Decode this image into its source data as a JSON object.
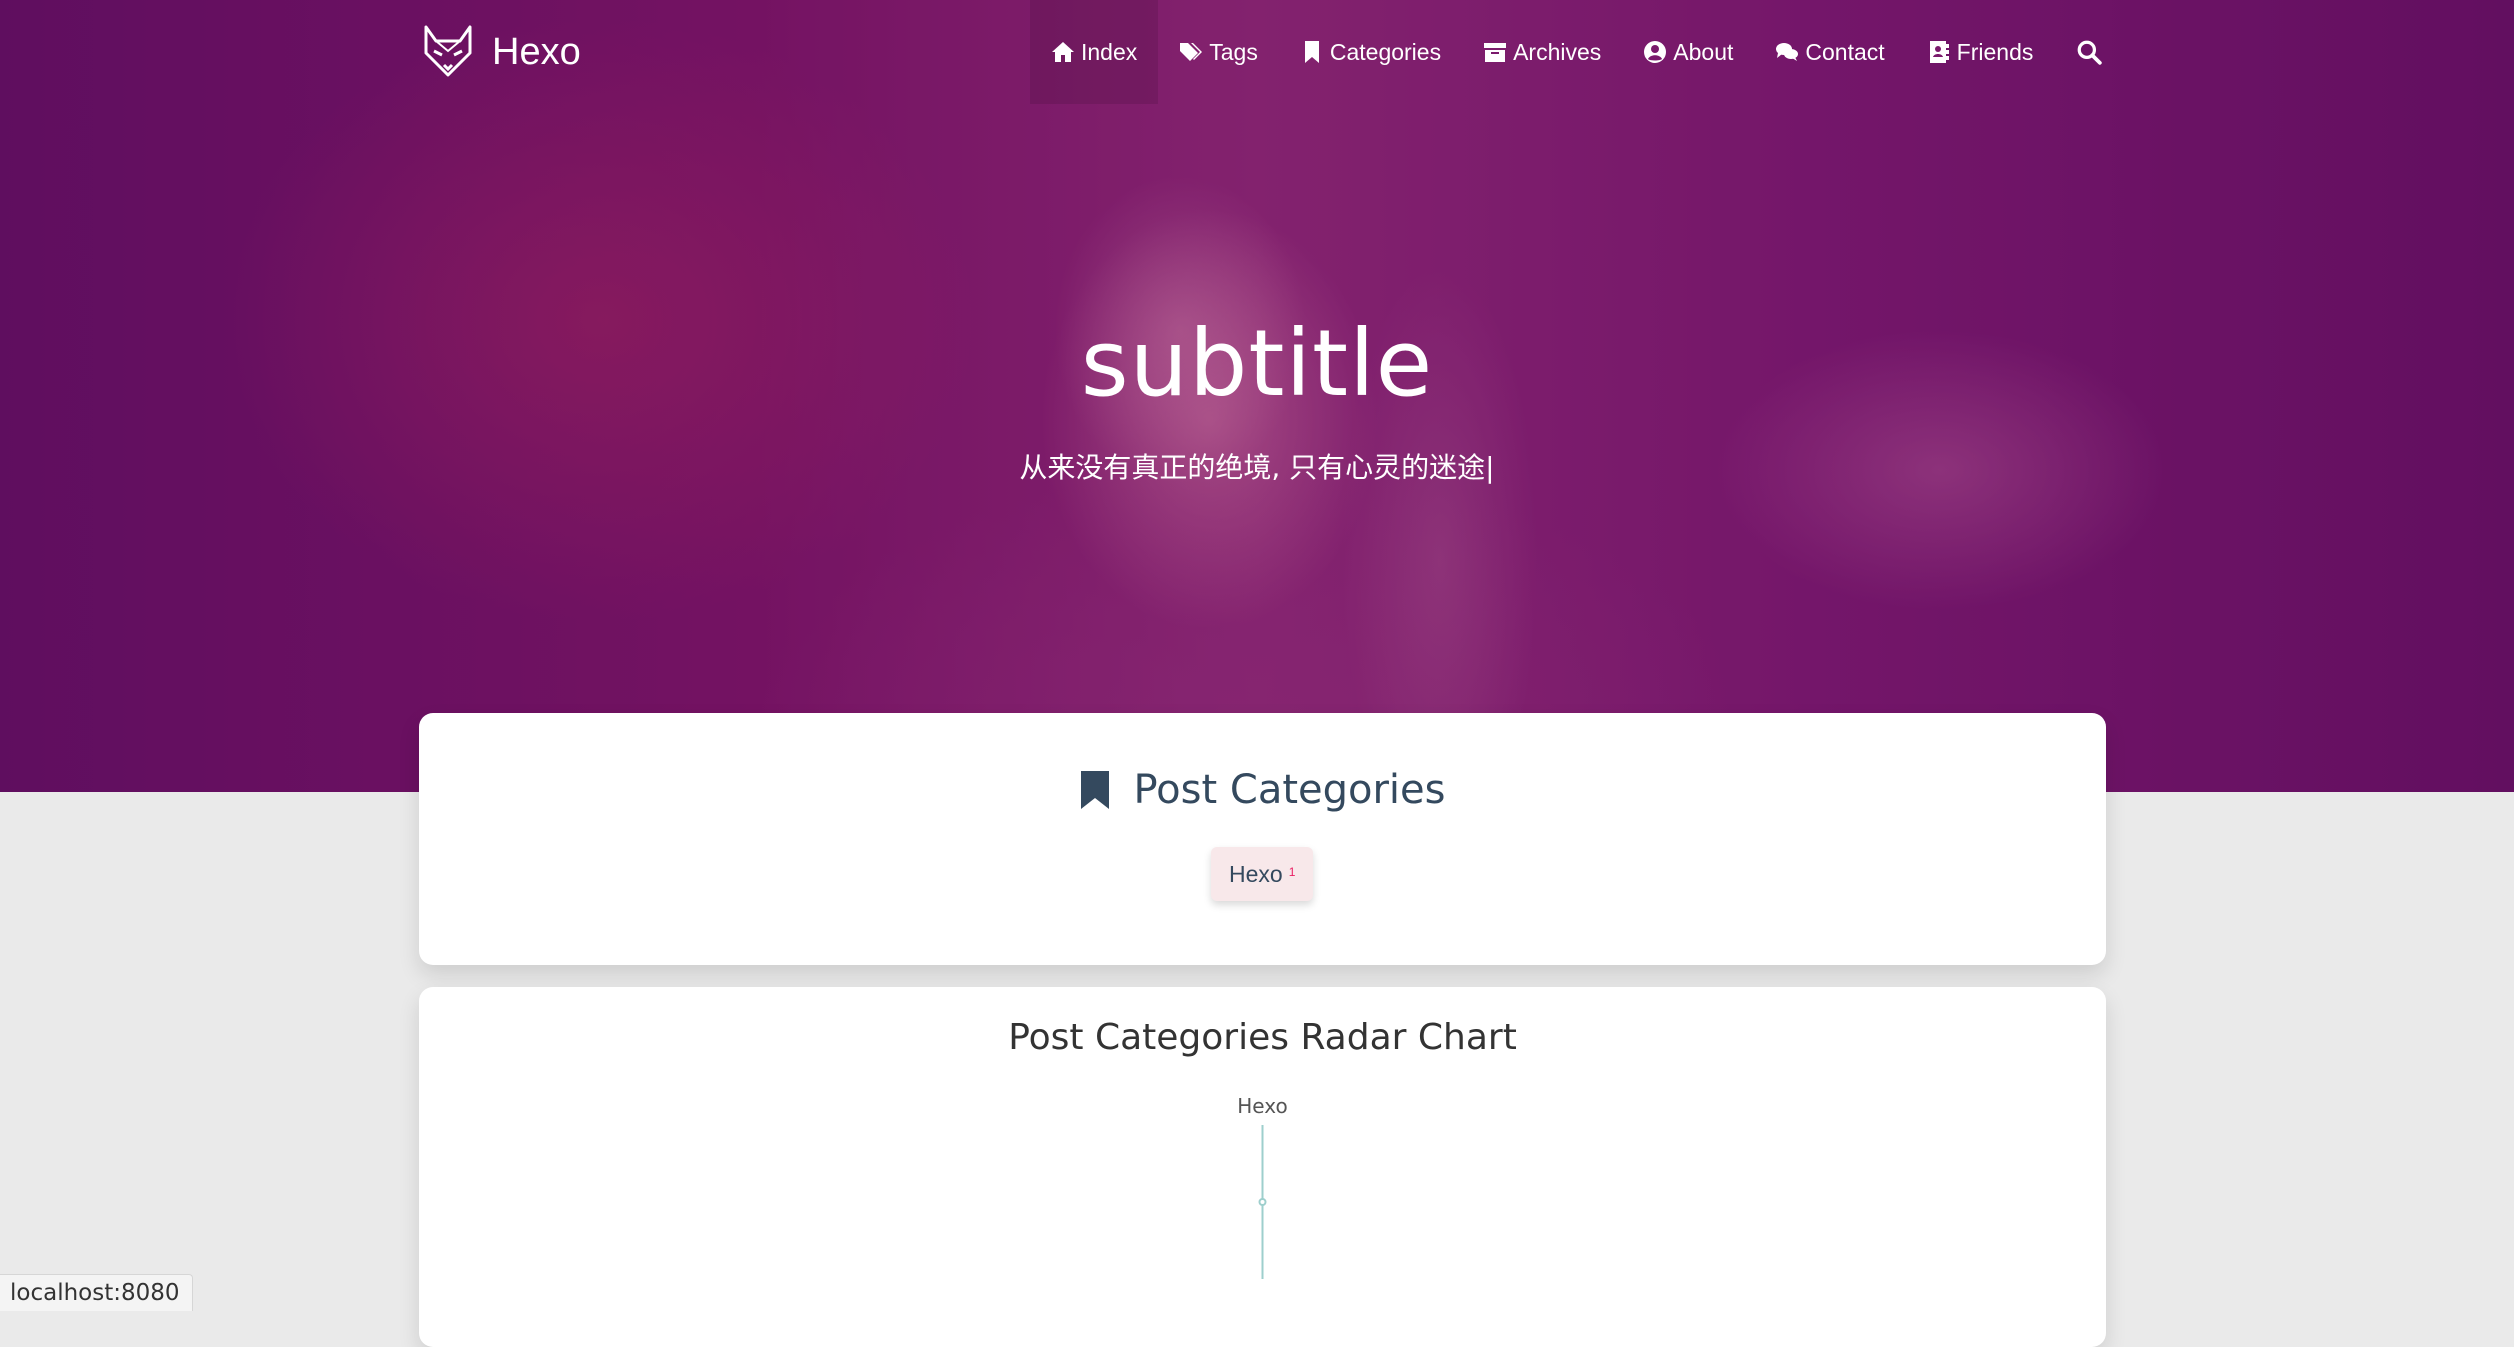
{
  "brand": {
    "name": "Hexo",
    "logo_icon": "fox-icon"
  },
  "nav": {
    "items": [
      {
        "label": "Index",
        "icon": "home-icon"
      },
      {
        "label": "Tags",
        "icon": "tags-icon"
      },
      {
        "label": "Categories",
        "icon": "bookmark-icon"
      },
      {
        "label": "Archives",
        "icon": "archive-icon"
      },
      {
        "label": "About",
        "icon": "user-circle-icon"
      },
      {
        "label": "Contact",
        "icon": "comments-icon"
      },
      {
        "label": "Friends",
        "icon": "address-book-icon"
      }
    ],
    "active_index": 0,
    "search_icon": "search-icon"
  },
  "hero": {
    "title": "subtitle",
    "subtitle": "从来没有真正的绝境, 只有心灵的迷途|"
  },
  "categories": {
    "title": "Post Categories",
    "items": [
      {
        "name": "Hexo",
        "count": "1"
      }
    ]
  },
  "radar": {
    "title": "Post Categories Radar Chart"
  },
  "chart_data": {
    "type": "radar",
    "title": "Post Categories Radar Chart",
    "indicators": [
      "Hexo"
    ],
    "series": [
      {
        "values": [
          1
        ]
      }
    ],
    "max": 2
  },
  "colors": {
    "accent_pink": "#e91e63",
    "heading": "#34495e",
    "chip_bg": "#f8e8ea",
    "radar_line": "#9ecfcd"
  },
  "status_bar": {
    "text": "localhost:8080"
  }
}
